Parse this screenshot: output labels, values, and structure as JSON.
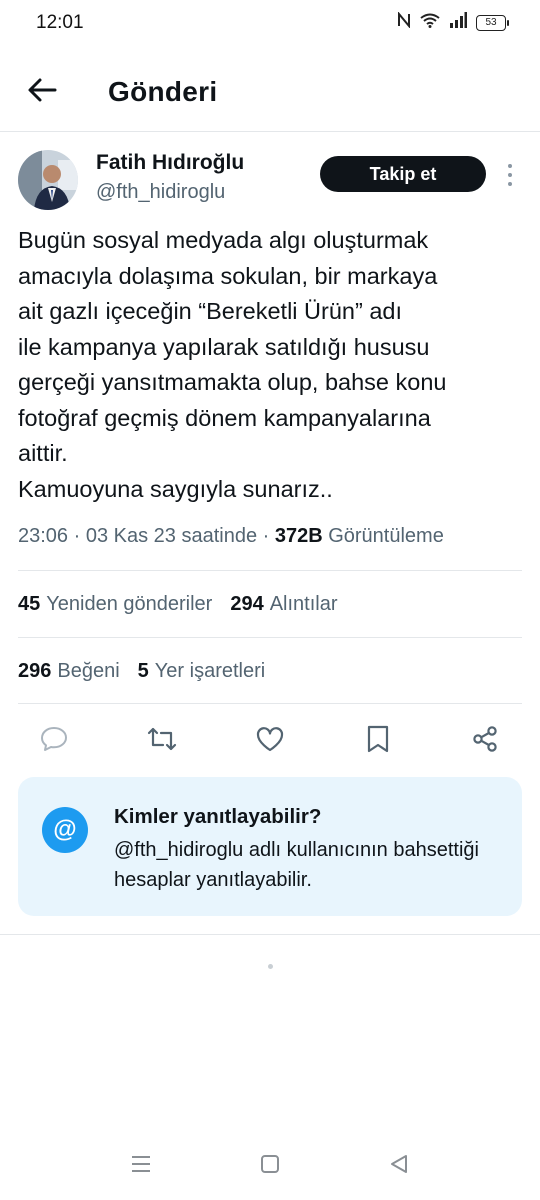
{
  "status_bar": {
    "time": "12:01",
    "battery": "53",
    "icons": [
      "nfc-icon",
      "wifi-icon",
      "signal-icon",
      "battery-icon"
    ]
  },
  "header": {
    "title": "Gönderi",
    "back_icon": "arrow-left-icon"
  },
  "author": {
    "name": "Fatih Hıdıroğlu",
    "handle": "@fth_hidiroglu",
    "follow_label": "Takip et"
  },
  "tweet": {
    "lines": [
      "Bugün sosyal medyada algı oluşturmak",
      "amacıyla dolaşıma sokulan, bir markaya",
      "ait gazlı içeceğin “Bereketli Ürün” adı",
      "ile kampanya yapılarak satıldığı hususu",
      "gerçeği yansıtmamakta olup, bahse konu",
      "fotoğraf geçmiş dönem kampanyalarına",
      "aittir.",
      "Kamuoyuna saygıyla sunarız.."
    ],
    "timestamp": "23:06 · 03 Kas 23 saatinde · ",
    "views_count": "372B",
    "views_label": "Görüntüleme"
  },
  "stats": {
    "reposts_count": "45",
    "reposts_label": "Yeniden gönderiler",
    "quotes_count": "294",
    "quotes_label": "Alıntılar",
    "likes_count": "296",
    "likes_label": "Beğeni",
    "bookmarks_count": "5",
    "bookmarks_label": "Yer işaretleri"
  },
  "actions": [
    "reply-icon",
    "repost-icon",
    "like-icon",
    "bookmark-icon",
    "share-icon"
  ],
  "reply_settings": {
    "title": "Kimler yanıtlayabilir?",
    "description": "@fth_hidiroglu adlı kullanıcının bahsettiği hesaplar yanıtlayabilir.",
    "badge": "@"
  },
  "colors": {
    "accent": "#1d9bf0",
    "text_primary": "#0f1419",
    "text_secondary": "#536471",
    "card_background": "#e8f5fd",
    "follow_button": "#0f1419"
  }
}
